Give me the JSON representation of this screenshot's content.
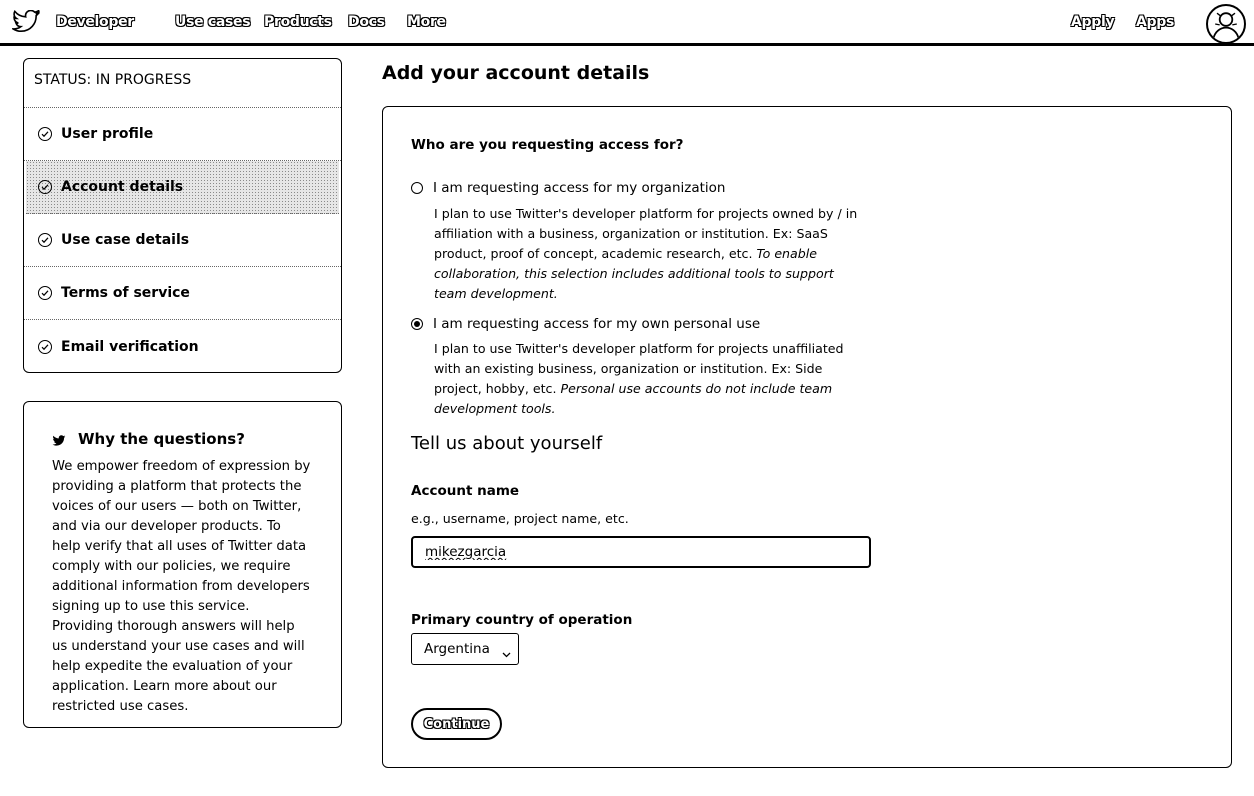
{
  "nav": {
    "logo_icon": "twitter-bird-icon",
    "brand": "Developer",
    "links": [
      "Use cases",
      "Products",
      "Docs",
      "More"
    ],
    "right_links": [
      "Apply",
      "Apps"
    ],
    "avatar_icon": "user-avatar"
  },
  "sidebar": {
    "status": "STATUS: IN PROGRESS",
    "steps": [
      {
        "label": "User profile"
      },
      {
        "label": "Account details"
      },
      {
        "label": "Use case details"
      },
      {
        "label": "Terms of service"
      },
      {
        "label": "Email verification"
      }
    ],
    "active_step": "Account details"
  },
  "info": {
    "title": "Why the questions?",
    "body": "We empower freedom of expression by providing a platform that protects the voices of our users — both on Twitter, and via our developer products. To help verify that all uses of Twitter data comply with our policies, we require additional information from developers signing up to use this service. Providing thorough answers will help us understand your use cases and will help expedite the evaluation of your application. Learn more about our restricted use cases."
  },
  "main": {
    "title": "Add your account details",
    "question": "Who are you requesting access for?",
    "options": [
      {
        "label": "I am requesting access for my organization",
        "desc": "I plan to use Twitter's developer platform for projects owned by / in affiliation with a business, organization or institution. Ex: SaaS product, proof of concept, academic research, etc.",
        "desc_italic": "To enable collaboration, this selection includes additional tools to support team development.",
        "selected": false
      },
      {
        "label": "I am requesting access for my own personal use",
        "desc": "I plan to use Twitter's developer platform for projects unaffiliated with an existing business, organization or institution. Ex: Side project, hobby, etc.",
        "desc_italic": "Personal use accounts do not include team development tools.",
        "selected": true
      }
    ],
    "section_title": "Tell us about yourself",
    "account_name_label": "Account name",
    "account_name_hint": "e.g., username, project name, etc.",
    "account_name_value": "mikezgarcia",
    "country_label": "Primary country of operation",
    "country_value": "Argentina",
    "continue_label": "Continue"
  }
}
